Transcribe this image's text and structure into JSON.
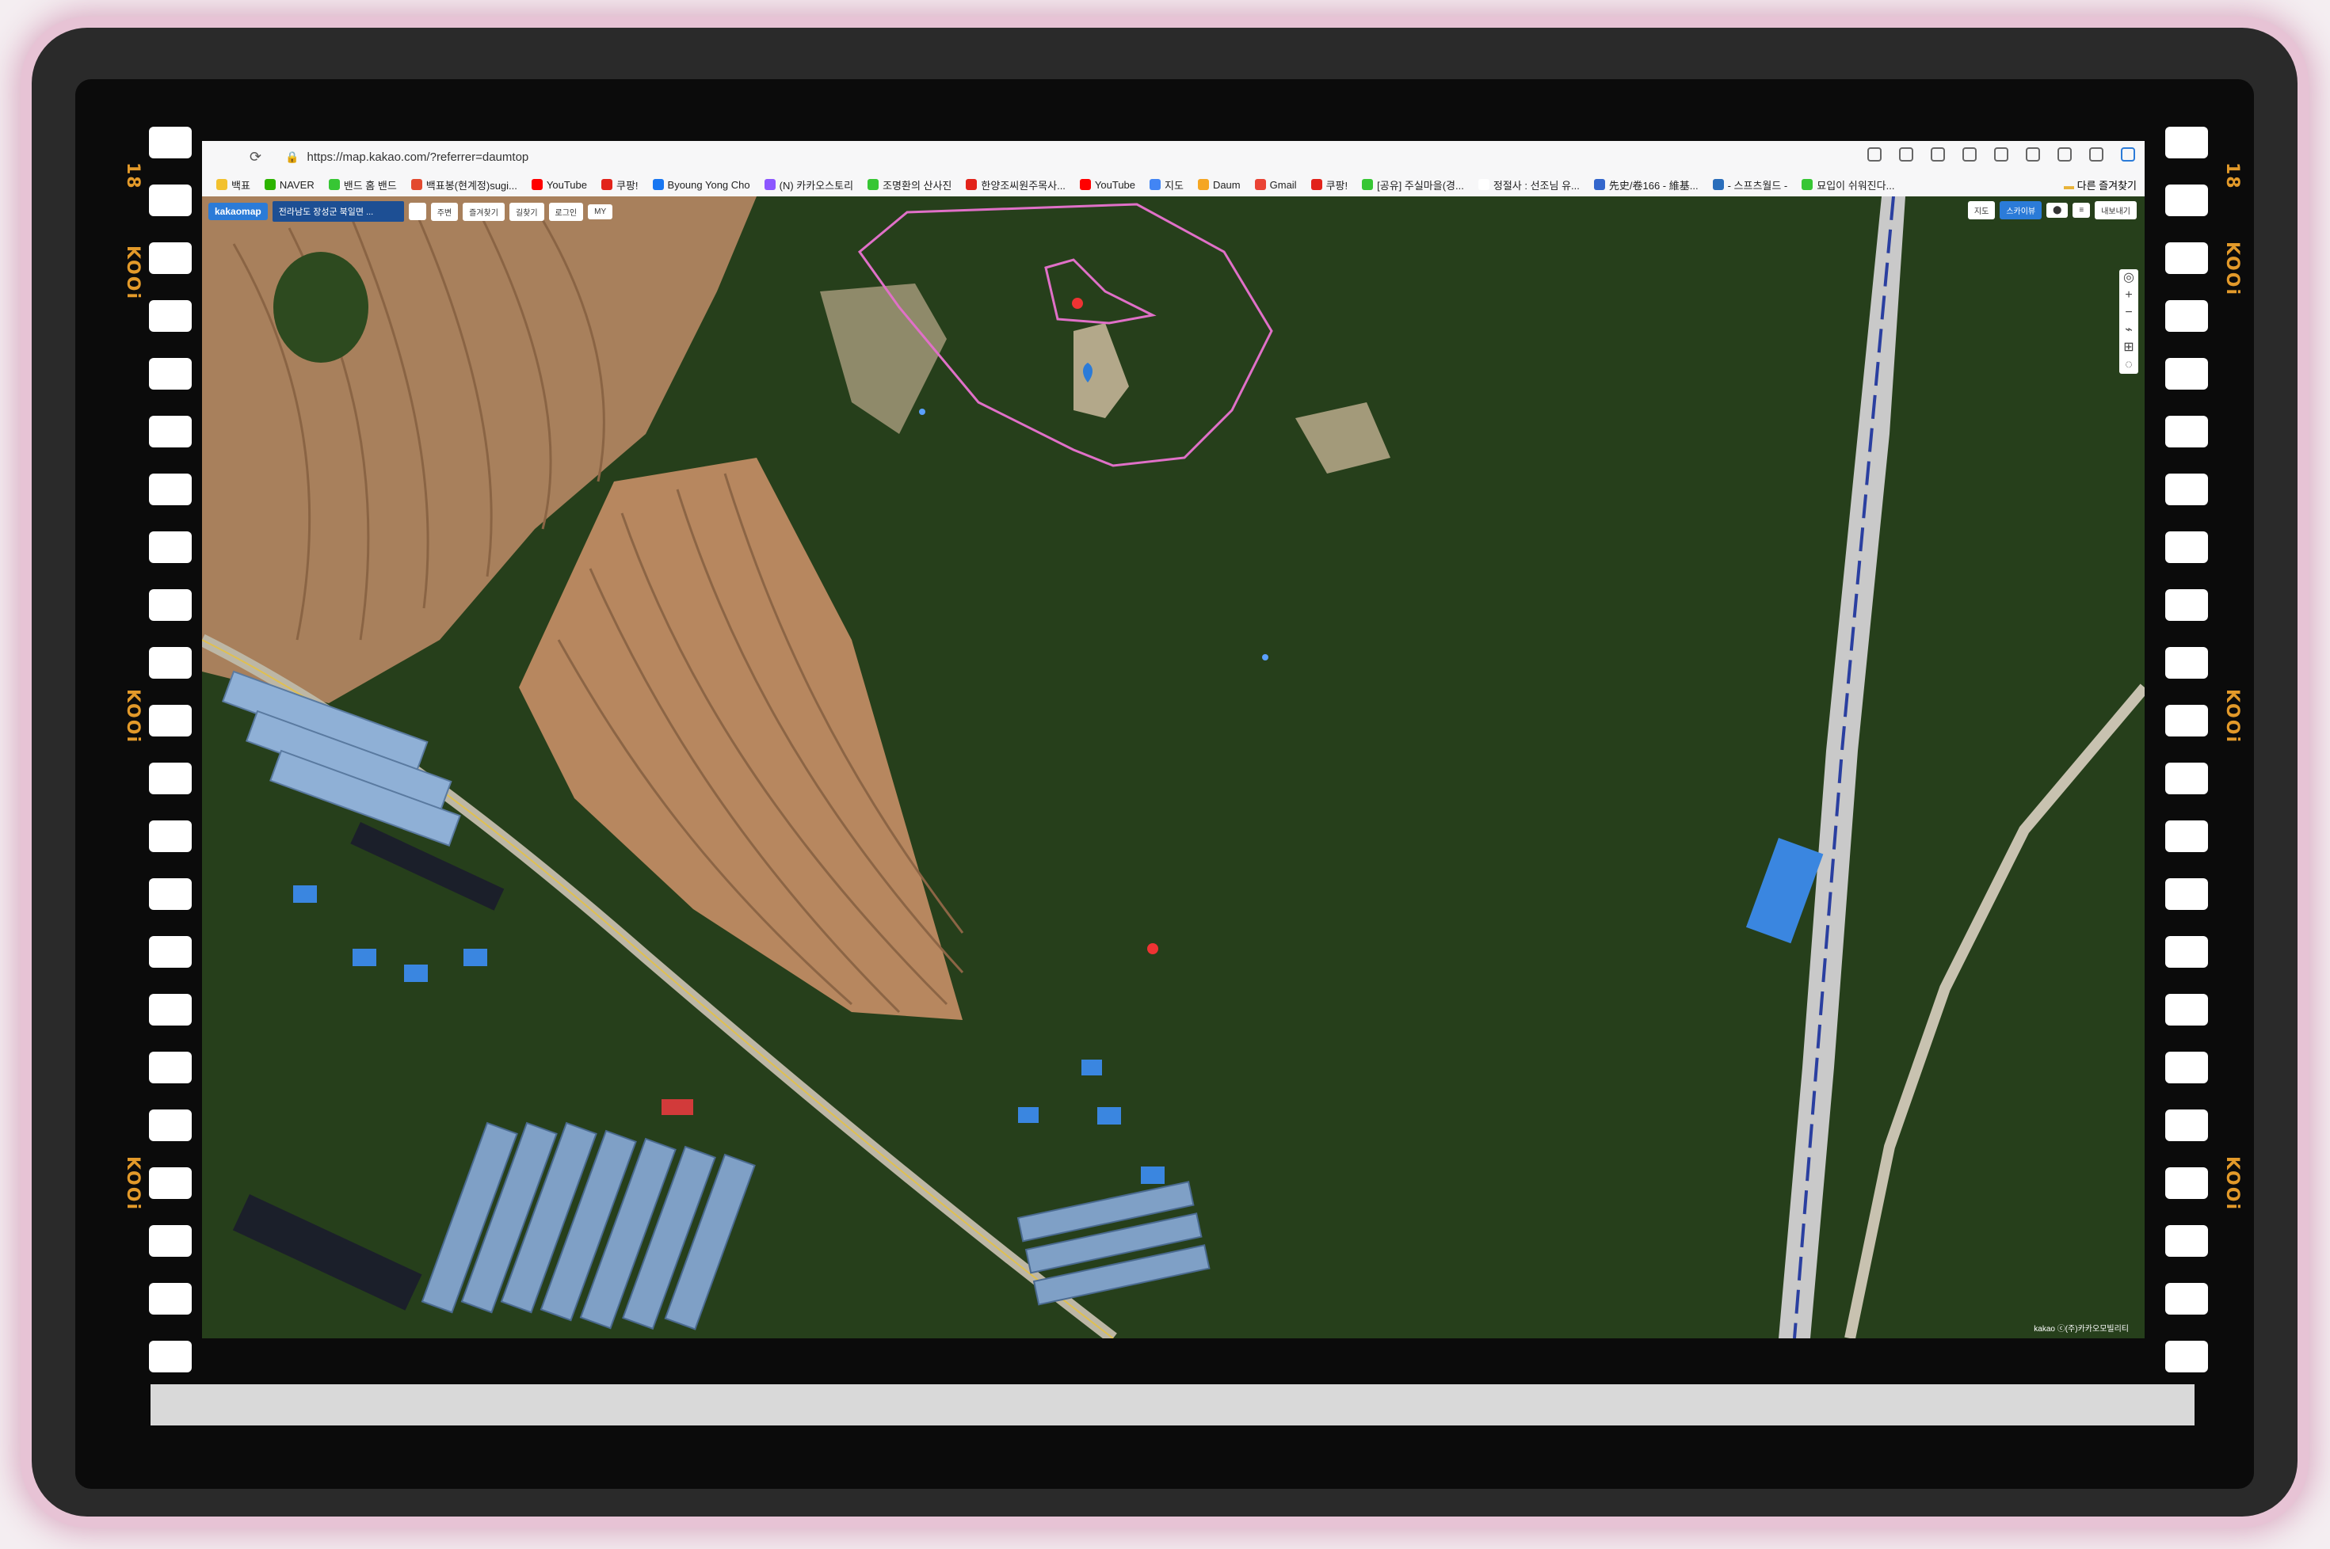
{
  "browser": {
    "url": "https://map.kakao.com/?referrer=daumtop",
    "bookmarks": [
      {
        "label": "백표",
        "color": "#f2c12e"
      },
      {
        "label": "NAVER",
        "color": "#2db400"
      },
      {
        "label": "밴드 홈 밴드",
        "color": "#37c634"
      },
      {
        "label": "백표봉(현계정)sugi...",
        "color": "#e34a2f"
      },
      {
        "label": "YouTube",
        "color": "#ff0000"
      },
      {
        "label": "쿠팡!",
        "color": "#e2231a"
      },
      {
        "label": "Byoung Yong Cho",
        "color": "#1877f2"
      },
      {
        "label": "(N) 카카오스토리",
        "color": "#8c57ff"
      },
      {
        "label": "조명환의 산사진",
        "color": "#37c634"
      },
      {
        "label": "한양조씨원주목사...",
        "color": "#e2231a"
      },
      {
        "label": "YouTube",
        "color": "#ff0000"
      },
      {
        "label": "지도",
        "color": "#4285f4"
      },
      {
        "label": "Daum",
        "color": "#f5a623"
      },
      {
        "label": "Gmail",
        "color": "#ea4335"
      },
      {
        "label": "쿠팡!",
        "color": "#e2231a"
      },
      {
        "label": "[공유] 주실마을(경...",
        "color": "#37c634"
      },
      {
        "label": "정절사 : 선조님 유...",
        "color": "#ffffff"
      },
      {
        "label": "先史/卷166 - 維基...",
        "color": "#3366cc"
      },
      {
        "label": "- 스프츠월드 -",
        "color": "#2a6ebb"
      },
      {
        "label": "묘입이 쉬워진다...",
        "color": "#37c634"
      }
    ],
    "other_bookmarks": "다른 즐겨찾기"
  },
  "map_ui": {
    "logo": "kakaomap",
    "search_value": "전라남도 장성군 북일면 ...",
    "buttons": [
      "주변",
      "즐겨찾기",
      "길찾기",
      "로그인",
      "MY"
    ],
    "map_types": [
      "지도",
      "스카이뷰"
    ],
    "active_map_type": "스카이뷰",
    "right_button": "내보내기",
    "copyright": "kakao ⓒ(주)카카오모빌리티"
  },
  "film": {
    "edge_left": "18",
    "edge_mark": "KOOi",
    "edge_right": "18"
  },
  "colors": {
    "boundary": "#e070c8",
    "field": "#b9875e",
    "forest": "#243e1a",
    "greenhouse": "#8fb0d6",
    "blue_roof": "#3a86e0",
    "railway": "#d8d8d8"
  }
}
